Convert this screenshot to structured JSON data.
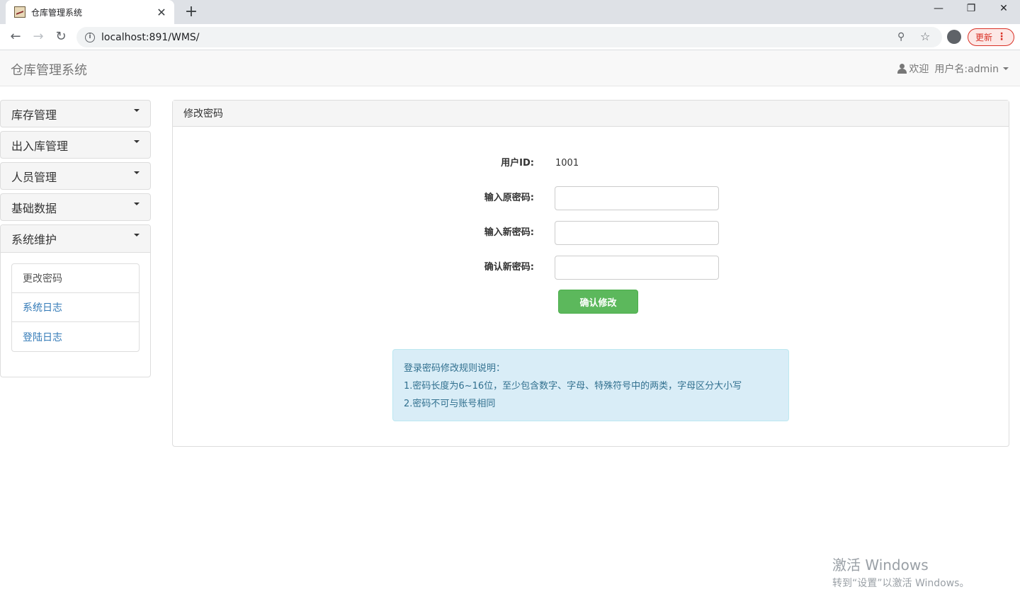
{
  "browser": {
    "tab_title": "仓库管理系统",
    "tab_close": "✕",
    "new_tab": "+",
    "url": "localhost:891/WMS/",
    "update_label": "更新",
    "icons": [
      "back-icon",
      "forward-icon",
      "reload-icon",
      "info-icon",
      "key-icon",
      "star-icon",
      "profile-icon",
      "menu-dots-icon"
    ]
  },
  "navbar": {
    "brand": "仓库管理系统",
    "welcome": "欢迎",
    "username": "用户名:admin"
  },
  "sidebar": {
    "panels": [
      {
        "label": "库存管理"
      },
      {
        "label": "出入库管理"
      },
      {
        "label": "人员管理"
      },
      {
        "label": "基础数据"
      },
      {
        "label": "系统维护"
      }
    ],
    "submenu": [
      {
        "label": "更改密码"
      },
      {
        "label": "系统日志"
      },
      {
        "label": "登陆日志"
      }
    ]
  },
  "main": {
    "title": "修改密码",
    "user_id_label": "用户ID:",
    "user_id_value": "1001",
    "old_password_label": "输入原密码:",
    "new_password_label": "输入新密码:",
    "confirm_password_label": "确认新密码:",
    "submit_label": "确认修改",
    "rules_title": "登录密码修改规则说明：",
    "rule_1": "1.密码长度为6~16位，至少包含数字、字母、特殊符号中的两类，字母区分大小写",
    "rule_2": "2.密码不可与账号相同"
  },
  "watermark": {
    "title": "激活 Windows",
    "subtitle": "转到“设置”以激活 Windows。"
  },
  "colors": {
    "primary_link": "#337ab7",
    "success": "#5cb85c",
    "info_bg": "#d9edf7",
    "info_text": "#31708f"
  }
}
